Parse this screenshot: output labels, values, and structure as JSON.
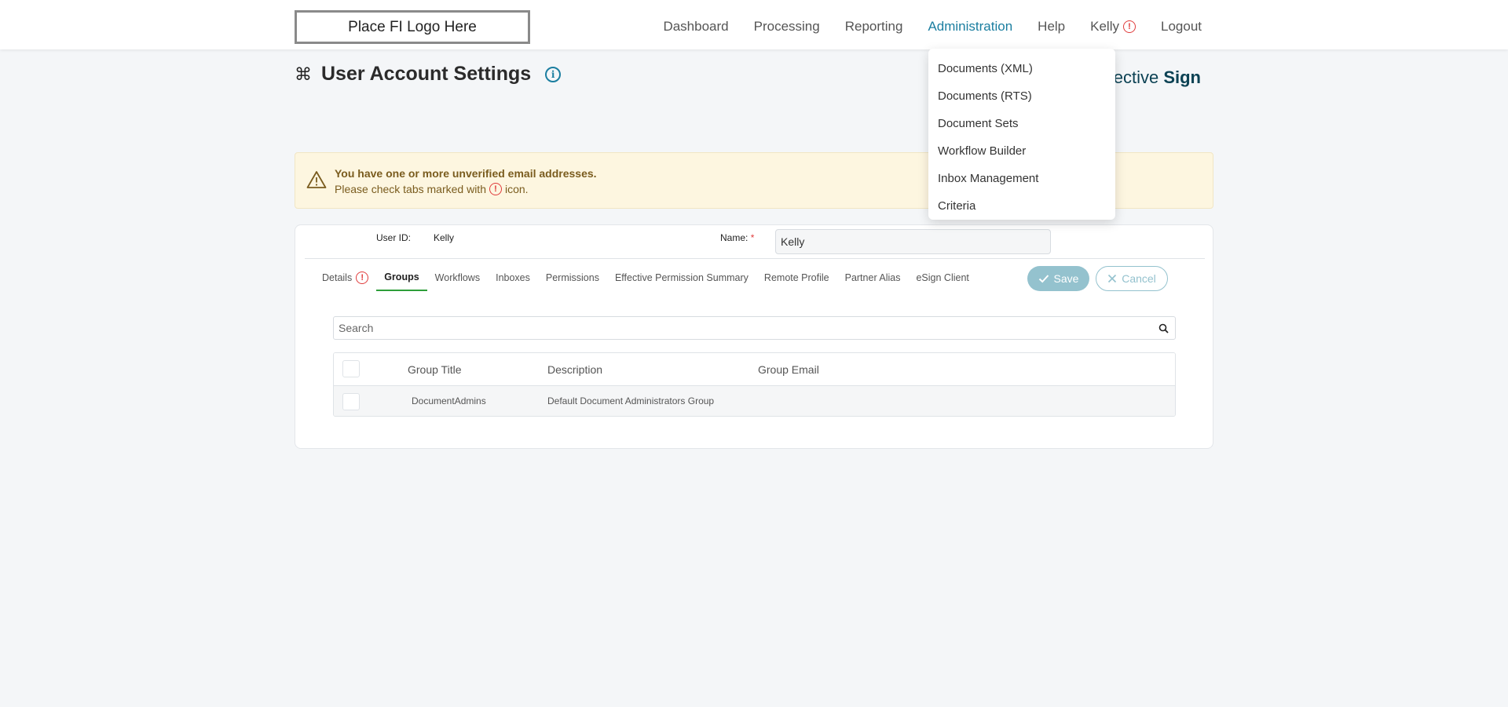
{
  "header": {
    "logo_text": "Place FI Logo Here",
    "nav": [
      {
        "label": "Dashboard"
      },
      {
        "label": "Processing"
      },
      {
        "label": "Reporting"
      },
      {
        "label": "Administration"
      },
      {
        "label": "Help"
      },
      {
        "label": "Kelly"
      },
      {
        "label": "Logout"
      }
    ],
    "active_nav": "Administration"
  },
  "admin_menu": {
    "items": [
      {
        "label": "Documents (XML)"
      },
      {
        "label": "Documents (RTS)"
      },
      {
        "label": "Document Sets"
      },
      {
        "label": "Workflow Builder"
      },
      {
        "label": "Inbox Management"
      },
      {
        "label": "Criteria"
      }
    ]
  },
  "page": {
    "title": "User Account Settings",
    "brand_light": "ective",
    "brand_bold": "Sign"
  },
  "warning": {
    "title": "You have one or more unverified email addresses.",
    "sub_before": "Please check tabs marked with",
    "sub_after": "icon."
  },
  "user": {
    "user_id_label": "User ID:",
    "user_id_value": "Kelly",
    "name_label": "Name:",
    "name_required_mark": "*",
    "name_value": "Kelly"
  },
  "tabs": [
    {
      "label": "Details"
    },
    {
      "label": "Groups"
    },
    {
      "label": "Workflows"
    },
    {
      "label": "Inboxes"
    },
    {
      "label": "Permissions"
    },
    {
      "label": "Effective Permission Summary"
    },
    {
      "label": "Remote Profile"
    },
    {
      "label": "Partner Alias"
    },
    {
      "label": "eSign Client"
    }
  ],
  "active_tab": "Groups",
  "actions": {
    "save_label": "Save",
    "cancel_label": "Cancel"
  },
  "search": {
    "placeholder": "Search",
    "value": ""
  },
  "groups_table": {
    "columns": [
      "Group Title",
      "Description",
      "Group Email"
    ],
    "rows": [
      {
        "title": "DocumentAdmins",
        "description": "Default Document Administrators Group",
        "email": ""
      }
    ]
  },
  "colors": {
    "accent": "#1b7ea0",
    "alert": "#e03c3c",
    "tab_underline": "#2e9e3a",
    "save_bg": "#94c2ce",
    "warning_bg": "#fdf6e0"
  }
}
